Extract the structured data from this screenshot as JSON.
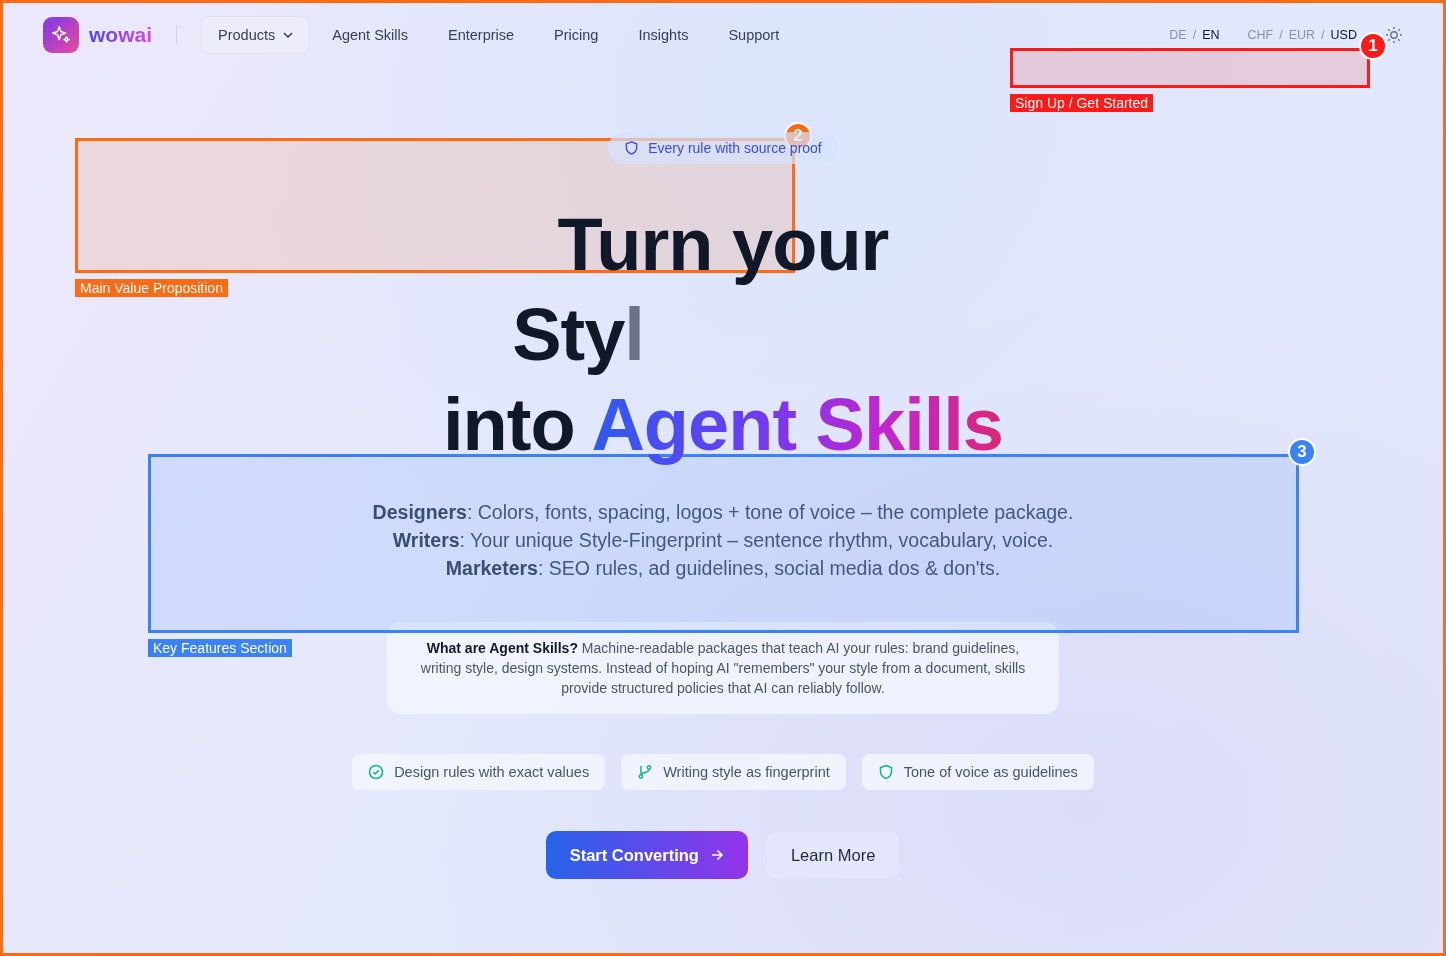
{
  "nav": {
    "brand": "wowai",
    "items": [
      {
        "label": "Products",
        "kind": "dropdown"
      },
      {
        "label": "Agent Skills",
        "kind": "link"
      },
      {
        "label": "Enterprise",
        "kind": "link"
      },
      {
        "label": "Pricing",
        "kind": "link"
      },
      {
        "label": "Insights",
        "kind": "link"
      },
      {
        "label": "Support",
        "kind": "link"
      }
    ],
    "separator": "/",
    "languages": [
      {
        "label": "DE",
        "selected": false
      },
      {
        "label": "EN",
        "selected": true
      }
    ],
    "currencies": [
      {
        "label": "CHF",
        "selected": false
      },
      {
        "label": "EUR",
        "selected": false
      },
      {
        "label": "USD",
        "selected": true
      }
    ]
  },
  "hero": {
    "badge": "Every rule with source proof",
    "headline": [
      {
        "parts": [
          {
            "text": "Turn your",
            "kind": "plain"
          }
        ]
      },
      {
        "parts": [
          {
            "text": "Sty",
            "kind": "plain"
          },
          {
            "text": "l",
            "kind": "typing"
          }
        ]
      },
      {
        "parts": [
          {
            "text": "into ",
            "kind": "plain"
          },
          {
            "text": "Agent Skills",
            "kind": "gradient"
          }
        ]
      }
    ],
    "features": [
      "**Designers**: Colors, fonts, spacing, logos + tone of voice – the complete package.",
      "**Writers**: Your unique Style-Fingerprint – sentence rhythm, vocabulary, voice.",
      "**Marketers**: SEO rules, ad guidelines, social media dos & don'ts."
    ],
    "info": "**What are Agent Skills?** Machine-readable packages that teach AI your rules: brand guidelines, writing style, design systems. Instead of hoping AI \"remembers\" your style from a document, skills provide structured policies that AI can reliably follow.",
    "pills": [
      {
        "label": "Design rules with exact values",
        "kind": "check"
      },
      {
        "label": "Writing style as fingerprint",
        "kind": "branch"
      },
      {
        "label": "Tone of voice as guidelines",
        "kind": "shield"
      }
    ],
    "buttons": [
      {
        "label": "Start Converting",
        "kind": "primary"
      },
      {
        "label": "Learn More",
        "kind": "secondary"
      }
    ]
  },
  "annotations": [
    {
      "number": "1",
      "label": "Sign Up / Get Started",
      "color": "#ff1a1a"
    },
    {
      "number": "2",
      "label": "Main Value Proposition",
      "color": "#ff6a13"
    },
    {
      "number": "3",
      "label": "Key Features Section",
      "color": "#3b82f6"
    }
  ]
}
